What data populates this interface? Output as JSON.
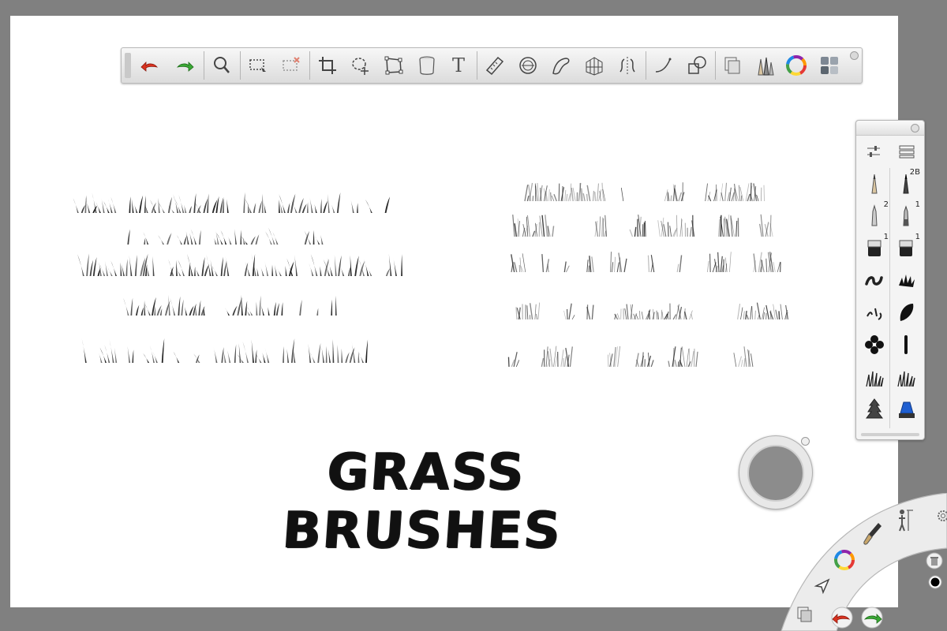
{
  "canvas_title": "GRASS BRUSHES",
  "toolbar": {
    "items": [
      {
        "name": "undo-button",
        "icon": "undo-arrow-red-icon"
      },
      {
        "name": "redo-button",
        "icon": "redo-arrow-green-icon"
      },
      {
        "name": "zoom-button",
        "icon": "magnifier-icon"
      },
      {
        "name": "select-button",
        "icon": "marquee-select-icon"
      },
      {
        "name": "clear-select-button",
        "icon": "marquee-clear-icon"
      },
      {
        "name": "crop-button",
        "icon": "crop-icon"
      },
      {
        "name": "transform-button",
        "icon": "lasso-move-icon"
      },
      {
        "name": "distort-button",
        "icon": "distort-icon"
      },
      {
        "name": "flood-fill-button",
        "icon": "paint-bucket-icon"
      },
      {
        "name": "text-button",
        "icon": "text-icon",
        "label": "T"
      },
      {
        "name": "ruler-button",
        "icon": "ruler-icon"
      },
      {
        "name": "ellipse-guide-button",
        "icon": "ellipse-guide-icon"
      },
      {
        "name": "french-curve-button",
        "icon": "french-curve-icon"
      },
      {
        "name": "perspective-button",
        "icon": "perspective-icon"
      },
      {
        "name": "symmetry-button",
        "icon": "symmetry-icon"
      },
      {
        "name": "stroke-tool-button",
        "icon": "curve-stroke-icon"
      },
      {
        "name": "shapes-button",
        "icon": "shapes-icon"
      },
      {
        "name": "layers-button",
        "icon": "layers-icon"
      },
      {
        "name": "brushes-button",
        "icon": "brush-pencils-icon"
      },
      {
        "name": "color-wheel-button",
        "icon": "color-wheel-icon"
      },
      {
        "name": "copic-library-button",
        "icon": "swatch-grid-icon"
      }
    ]
  },
  "brush_panel": {
    "tabs": [
      {
        "name": "brush-settings-tab",
        "icon": "sliders-icon"
      },
      {
        "name": "brush-library-tab",
        "icon": "list-icon"
      }
    ],
    "brushes": [
      {
        "name": "pencil-brush",
        "icon": "pencil-icon",
        "badge": ""
      },
      {
        "name": "pencil-2b-brush",
        "icon": "pencil-dark-icon",
        "badge": "2B"
      },
      {
        "name": "ballpoint-brush",
        "icon": "pen-icon",
        "badge": "2"
      },
      {
        "name": "fineliner-brush",
        "icon": "pen-fine-icon",
        "badge": "1"
      },
      {
        "name": "marker-brush",
        "icon": "marker-icon",
        "badge": "1"
      },
      {
        "name": "marker-2-brush",
        "icon": "marker-icon",
        "badge": "1"
      },
      {
        "name": "squiggle-brush",
        "icon": "squiggle-icon",
        "badge": ""
      },
      {
        "name": "splatter-brush",
        "icon": "splatter-icon",
        "badge": ""
      },
      {
        "name": "ink-brush",
        "icon": "ink-tips-icon",
        "badge": ""
      },
      {
        "name": "leaf-brush",
        "icon": "leaf-icon",
        "badge": ""
      },
      {
        "name": "flower-brush",
        "icon": "flower-icon",
        "badge": ""
      },
      {
        "name": "line-brush",
        "icon": "line-icon",
        "badge": ""
      },
      {
        "name": "grass-brush",
        "icon": "grass-icon",
        "badge": ""
      },
      {
        "name": "grass-2-brush",
        "icon": "grass-icon",
        "badge": ""
      },
      {
        "name": "fir-brush",
        "icon": "fir-tree-icon",
        "badge": ""
      },
      {
        "name": "eraser-brush",
        "icon": "eraser-blue-icon",
        "badge": ""
      }
    ]
  },
  "color_puck": {
    "color": "#8c8c8c"
  },
  "lagoon": {
    "items": [
      {
        "name": "lagoon-settings-button",
        "icon": "gear-icon"
      },
      {
        "name": "lagoon-perspective-button",
        "icon": "figure-icon"
      },
      {
        "name": "lagoon-brush-button",
        "icon": "paintbrush-icon"
      },
      {
        "name": "lagoon-color-button",
        "icon": "color-wheel-icon"
      },
      {
        "name": "lagoon-select-button",
        "icon": "select-arrow-icon"
      },
      {
        "name": "lagoon-layers-button",
        "icon": "layers-icon"
      },
      {
        "name": "lagoon-undo-button",
        "icon": "undo-arrow-red-icon"
      },
      {
        "name": "lagoon-redo-button",
        "icon": "redo-arrow-green-icon"
      },
      {
        "name": "lagoon-trash-button",
        "icon": "trash-icon"
      },
      {
        "name": "lagoon-color-dot",
        "icon": "black-dot-icon"
      }
    ]
  },
  "colors": {
    "background": "#808080",
    "canvas": "#ffffff",
    "ink": "#111111"
  }
}
